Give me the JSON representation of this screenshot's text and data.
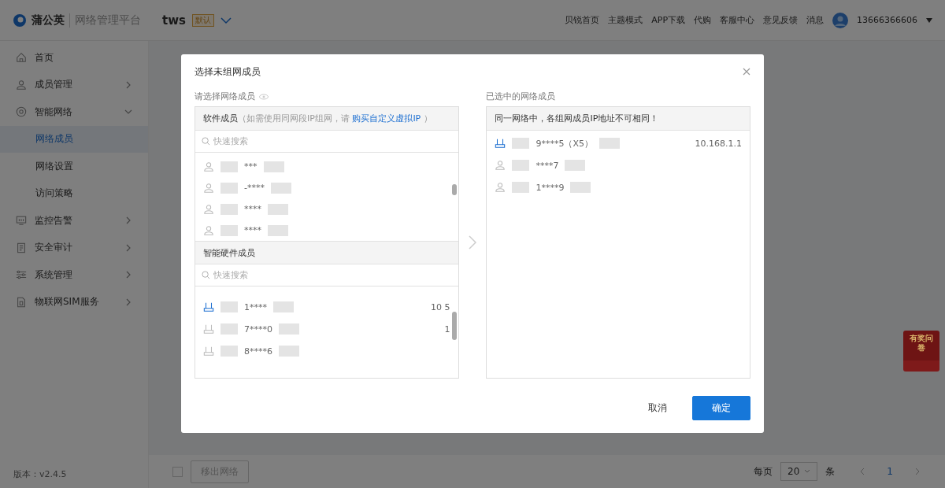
{
  "brand": {
    "name": "蒲公英",
    "product": "网络管理平台"
  },
  "network": {
    "name": "tws",
    "badge": "默认"
  },
  "top_links": [
    "贝锐首页",
    "主题模式",
    "APP下载",
    "代购",
    "客服中心",
    "意见反馈",
    "消息"
  ],
  "user": {
    "phone": "13666366606"
  },
  "survey_badge": "有奖问卷",
  "sidebar": {
    "items": [
      {
        "label": "首页",
        "selected": false
      },
      {
        "label": "成员管理",
        "expanded": false,
        "selected": false
      },
      {
        "label": "智能网络",
        "expanded": true,
        "selected": false,
        "children": [
          {
            "label": "网络成员",
            "selected": true
          },
          {
            "label": "网络设置",
            "selected": false
          },
          {
            "label": "访问策略",
            "selected": false
          }
        ]
      },
      {
        "label": "监控告警",
        "expanded": false,
        "selected": false
      },
      {
        "label": "安全审计",
        "expanded": false,
        "selected": false
      },
      {
        "label": "系统管理",
        "expanded": false,
        "selected": false
      },
      {
        "label": "物联网SIM服务",
        "expanded": false,
        "selected": false
      }
    ],
    "version": "版本：v2.4.5"
  },
  "footer": {
    "select_all_checked": false,
    "remove_button": "移出网络",
    "per_page_label": "每页",
    "per_page": "20",
    "unit": "条",
    "page": "1"
  },
  "dialog": {
    "title": "选择未组网成员",
    "left_label": "请选择网络成员",
    "software": {
      "title": "软件成员",
      "note": "（如需使用同网段IP组网，请 ",
      "link": "购买自定义虚拟IP",
      "note_end": " ）",
      "search_placeholder": "快速搜索",
      "rows": [
        {
          "kind": "user",
          "name": "***"
        },
        {
          "kind": "user",
          "name": "-****"
        },
        {
          "kind": "user",
          "name": "****"
        },
        {
          "kind": "user",
          "name": "****"
        }
      ]
    },
    "hardware": {
      "title": "智能硬件成员",
      "search_placeholder": "快速搜索",
      "rows": [
        {
          "kind": "router",
          "name": "1****",
          "ip": "10 5",
          "online": true
        },
        {
          "kind": "router",
          "name": "7****0",
          "ip": "1",
          "online": false
        },
        {
          "kind": "router",
          "name": "8****6",
          "online": false
        }
      ]
    },
    "right_label": "已选中的网络成员",
    "notice": "同一网络中，各组网成员IP地址不可相同！",
    "selected": [
      {
        "kind": "router",
        "name": "9****5（X5）",
        "ip": "10.168.1.1",
        "online": true
      },
      {
        "kind": "user",
        "name": "****7"
      },
      {
        "kind": "user",
        "name": "1****9"
      }
    ],
    "cancel": "取消",
    "confirm": "确定"
  }
}
